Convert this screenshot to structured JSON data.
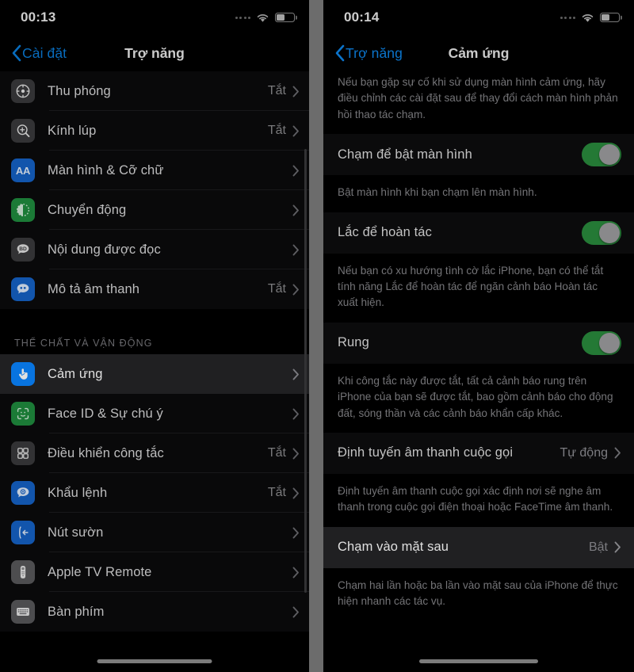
{
  "left_phone": {
    "status": {
      "time": "00:13",
      "signal_icon": "signal-dots-icon",
      "wifi_icon": "wifi-icon",
      "battery_icon": "battery-icon"
    },
    "nav": {
      "back_label": "Cài đặt",
      "title": "Trợ năng",
      "back_icon": "chevron-left-icon"
    },
    "rows": [
      {
        "label": "Thu phóng",
        "value": "Tắt",
        "icon": "zoom-icon",
        "icon_name": "zoom-icon"
      },
      {
        "label": "Kính lúp",
        "value": "Tắt",
        "icon": "magnifier-icon",
        "icon_name": "magnifier-icon"
      },
      {
        "label": "Màn hình & Cỡ chữ",
        "value": "",
        "icon": "display-text-size-icon",
        "icon_name": "display-text-size-icon"
      },
      {
        "label": "Chuyển động",
        "value": "",
        "icon": "motion-icon",
        "icon_name": "motion-icon"
      },
      {
        "label": "Nội dung được đọc",
        "value": "",
        "icon": "spoken-content-icon",
        "icon_name": "spoken-content-icon"
      },
      {
        "label": "Mô tả âm thanh",
        "value": "Tắt",
        "icon": "audio-description-icon",
        "icon_name": "audio-description-icon"
      }
    ],
    "section_header": "THỂ CHẤT VÀ VẬN ĐỘNG",
    "rows2": [
      {
        "label": "Cảm ứng",
        "value": "",
        "icon": "touch-icon",
        "selected": true
      },
      {
        "label": "Face ID & Sự chú ý",
        "value": "",
        "icon": "face-id-icon",
        "selected": false
      },
      {
        "label": "Điều khiển công tắc",
        "value": "Tắt",
        "icon": "switch-control-icon",
        "selected": false
      },
      {
        "label": "Khẩu lệnh",
        "value": "Tắt",
        "icon": "voice-control-icon",
        "selected": false
      },
      {
        "label": "Nút sườn",
        "value": "",
        "icon": "side-button-icon",
        "selected": false
      },
      {
        "label": "Apple TV Remote",
        "value": "",
        "icon": "apple-tv-remote-icon",
        "selected": false
      },
      {
        "label": "Bàn phím",
        "value": "",
        "icon": "keyboard-icon",
        "selected": false
      }
    ]
  },
  "right_phone": {
    "status": {
      "time": "00:14"
    },
    "nav": {
      "back_label": "Trợ năng",
      "title": "Cảm ứng",
      "back_icon": "chevron-left-icon"
    },
    "intro": "Nếu bạn gặp sự cố khi sử dụng màn hình cảm ứng, hãy điều chỉnh các cài đặt sau để thay đổi cách màn hình phản hồi thao tác chạm.",
    "items": [
      {
        "label": "Chạm để bật màn hình",
        "control": "toggle",
        "toggle_on": true,
        "footnote": "Bật màn hình khi bạn chạm lên màn hình."
      },
      {
        "label": "Lắc để hoàn tác",
        "control": "toggle",
        "toggle_on": true,
        "footnote": "Nếu bạn có xu hướng tình cờ lắc iPhone, bạn có thể tắt tính năng Lắc để hoàn tác để ngăn cảnh báo Hoàn tác xuất hiện."
      },
      {
        "label": "Rung",
        "control": "toggle",
        "toggle_on": true,
        "footnote": "Khi công tắc này được tắt, tất cả cảnh báo rung trên iPhone của bạn sẽ được tắt, bao gồm cảnh báo cho động đất, sóng thần và các cảnh báo khẩn cấp khác."
      },
      {
        "label": "Định tuyến âm thanh cuộc gọi",
        "control": "value",
        "value": "Tự động",
        "footnote": "Định tuyến âm thanh cuộc gọi xác định nơi sẽ nghe âm thanh trong cuộc gọi điện thoại hoặc FaceTime âm thanh."
      },
      {
        "label": "Chạm vào mặt sau",
        "control": "value",
        "value": "Bật",
        "highlight": true,
        "footnote": "Chạm hai lần hoặc ba lần vào mặt sau của iPhone để thực hiện nhanh các tác vụ."
      }
    ]
  },
  "colors": {
    "accent_blue": "#0a7bd8",
    "toggle_green": "#2a8a3d",
    "row_bg": "#0b0b0c",
    "selected_bg": "#252527",
    "divider_gray": "#7b7b7b"
  }
}
